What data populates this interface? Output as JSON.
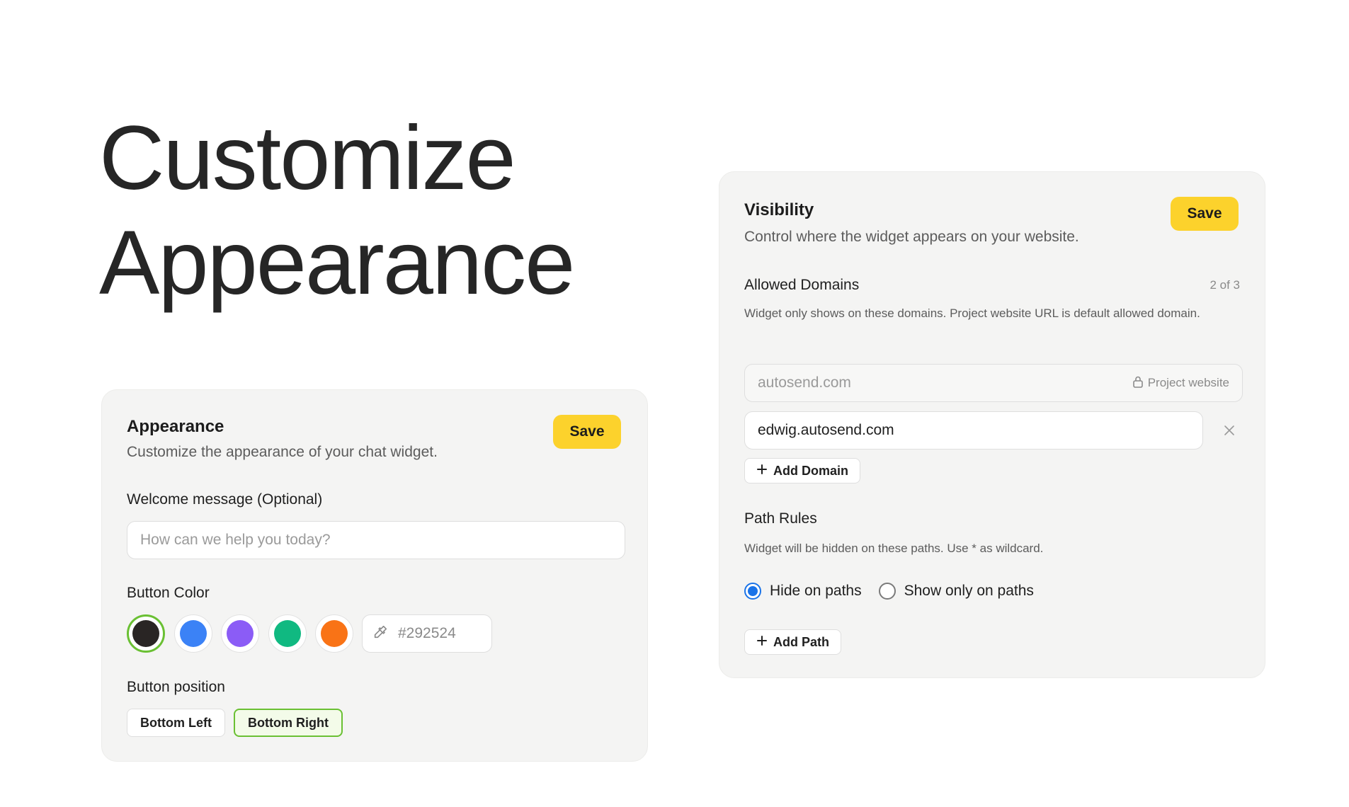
{
  "hero": {
    "line1": "Customize",
    "line2": "Appearance"
  },
  "appearance": {
    "title": "Appearance",
    "subtitle": "Customize the appearance of your chat widget.",
    "save_label": "Save",
    "welcome_label": "Welcome message (Optional)",
    "welcome_placeholder": "How can we help you today?",
    "button_color_label": "Button Color",
    "colors": [
      "#292524",
      "#3b82f6",
      "#8b5cf6",
      "#10b981",
      "#f97316"
    ],
    "selected_color_index": 0,
    "hex_value": "#292524",
    "button_position_label": "Button position",
    "positions": [
      "Bottom Left",
      "Bottom Right"
    ],
    "selected_position": "Bottom Right"
  },
  "visibility": {
    "title": "Visibility",
    "subtitle": "Control where the widget appears on your website.",
    "save_label": "Save",
    "allowed_domains_label": "Allowed Domains",
    "domain_count": "2 of 3",
    "domains_help": "Widget only shows on these domains. Project website URL is default allowed domain.",
    "default_domain": "autosend.com",
    "default_domain_tag": "Project website",
    "extra_domain": "edwig.autosend.com",
    "add_domain_label": "Add Domain",
    "path_rules_label": "Path Rules",
    "path_rules_help": "Widget will be hidden on these paths. Use * as wildcard.",
    "path_modes": [
      "Hide on paths",
      "Show only on paths"
    ],
    "selected_path_mode": "Hide on paths",
    "add_path_label": "Add Path"
  },
  "colors": {
    "accent_save": "#fcd22c",
    "selected_border": "#6ac033",
    "radio_active": "#1a73e8"
  }
}
